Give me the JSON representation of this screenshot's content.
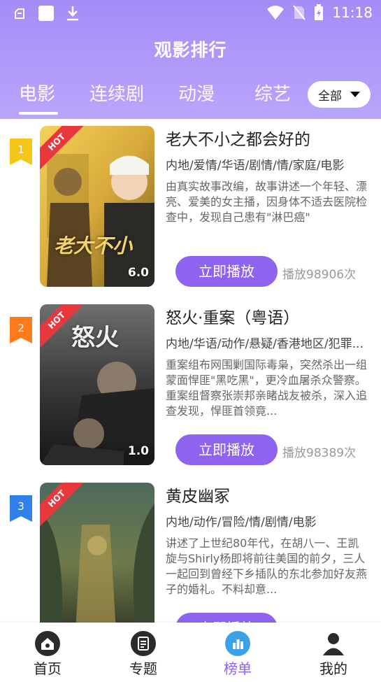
{
  "status_bar": {
    "time": "11:18"
  },
  "page_title": "观影排行",
  "tabs": [
    {
      "label": "电影",
      "active": true
    },
    {
      "label": "连续剧",
      "active": false
    },
    {
      "label": "动漫",
      "active": false
    },
    {
      "label": "综艺",
      "active": false
    }
  ],
  "filter": {
    "selected": "全部"
  },
  "items": [
    {
      "rank": "1",
      "rank_color": "#f5c518",
      "badge": "HOT",
      "score": "6.0",
      "title": "老大不小之都会好的",
      "tags": "内地/爱情/华语/剧情/情/家庭/电影",
      "desc": "由真实故事改编，故事讲述一个年轻、漂亮、爱美的女主播，因身体不适去医院检查中，发现自己患有\"淋巴癌\"",
      "play_label": "立即播放",
      "play_count": "播放98906次"
    },
    {
      "rank": "2",
      "rank_color": "#ff7a1a",
      "badge": "HOT",
      "score": "1.0",
      "title": "怒火·重案（粤语）",
      "tags": "内地/华语/动作/悬疑/香港地区/犯罪...",
      "desc": "重案组布网围剿国际毒枭，突然杀出一组蒙面悍匪\"黑吃黑\"，更冷血屠杀众警察。重案组督察张崇邦亲睹战友被杀，深入追查发现，悍匪首领竟...",
      "play_label": "立即播放",
      "play_count": "播放98389次"
    },
    {
      "rank": "3",
      "rank_color": "#2f80e8",
      "badge": "HOT",
      "score": "",
      "title": "黄皮幽冢",
      "tags": "内地/动作/冒险/情/剧情/电影",
      "desc": "讲述了上世纪80年代，在胡八一、王凯旋与Shirly杨即将前往美国的前夕，三人一起回到曾经下乡插队的东北参加好友燕子的婚礼。不料却意...",
      "play_label": "立即播放",
      "play_count": ""
    }
  ],
  "bottom_nav": [
    {
      "label": "首页",
      "icon": "home-icon",
      "active": false
    },
    {
      "label": "专题",
      "icon": "topic-icon",
      "active": false
    },
    {
      "label": "榜单",
      "icon": "chart-icon",
      "active": true
    },
    {
      "label": "我的",
      "icon": "user-icon",
      "active": false
    }
  ]
}
